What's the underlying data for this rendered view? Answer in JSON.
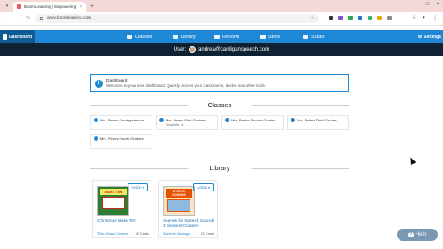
{
  "browser": {
    "tab_title": "Boom Learning | Empowering",
    "url": "wow.boomlearning.com",
    "tab_close": "×",
    "new_tab": "+",
    "win_min": "–",
    "win_max": "□",
    "win_close": "×"
  },
  "nav": {
    "brand": "Dashboard",
    "items": [
      {
        "label": "Classes",
        "icon": "classes-icon"
      },
      {
        "label": "Library",
        "icon": "library-icon"
      },
      {
        "label": "Reports",
        "icon": "reports-icon"
      },
      {
        "label": "Store",
        "icon": "store-icon"
      },
      {
        "label": "Studio",
        "icon": "studio-icon"
      }
    ],
    "settings": "Settings",
    "accent": "#1e88d6",
    "dark": "#0e5a93"
  },
  "user": {
    "prefix": "User:",
    "email": "andrea@cardiganspeech.com"
  },
  "notice": {
    "title": "Dashboard",
    "body": "Welcome to your new dashboard. Quickly access your classrooms, decks, and other tools."
  },
  "classes": {
    "heading": "Classes",
    "items": [
      {
        "name": "Mrs. Peters Kindergartenum",
        "sub": ""
      },
      {
        "name": "Mrs. Peters First Graders",
        "sub": "Students: 4"
      },
      {
        "name": "Mrs. Peters Second Grades",
        "sub": ""
      },
      {
        "name": "Mrs. Peters Third Grades",
        "sub": ""
      },
      {
        "name": "Mrs. Peters Fourth Graders",
        "sub": ""
      }
    ]
  },
  "library": {
    "heading": "Library",
    "decks": [
      {
        "title": "Christmas Make Ten",
        "author": "Third Grade Centers",
        "cards": "32 Cards",
        "action": "Action ▾",
        "thumb_text": "MAKE TEN"
      },
      {
        "title": "Scenes for Speech Sounds 3 Element Clusters",
        "author": "Speechy Musings",
        "cards": "21 Cards",
        "action": "Action ▾",
        "thumb_text": "SPEECH SOUNDS"
      }
    ]
  },
  "help": {
    "label": "Help"
  }
}
